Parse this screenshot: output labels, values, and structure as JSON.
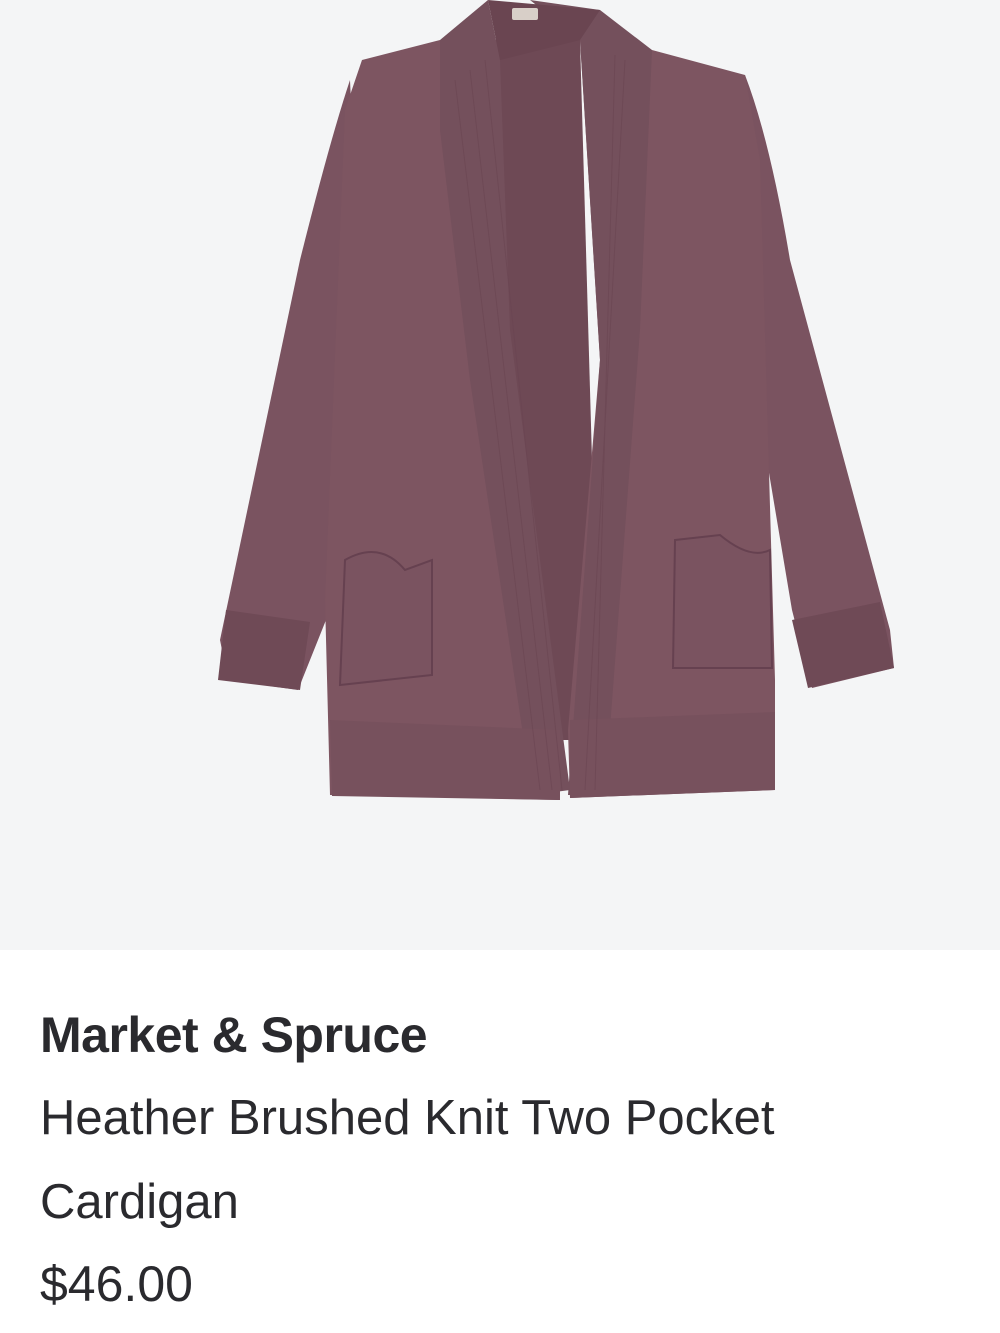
{
  "product": {
    "brand": "Market & Spruce",
    "name": "Heather Brushed Knit Two Pocket Cardigan",
    "price": "$46.00",
    "image_icon": "cardigan-product-image"
  },
  "colors": {
    "image_background": "#f4f5f6",
    "garment": "#7d5561",
    "garment_dark": "#6b4652",
    "garment_light": "#8a6270",
    "text": "#2a2a2e"
  }
}
